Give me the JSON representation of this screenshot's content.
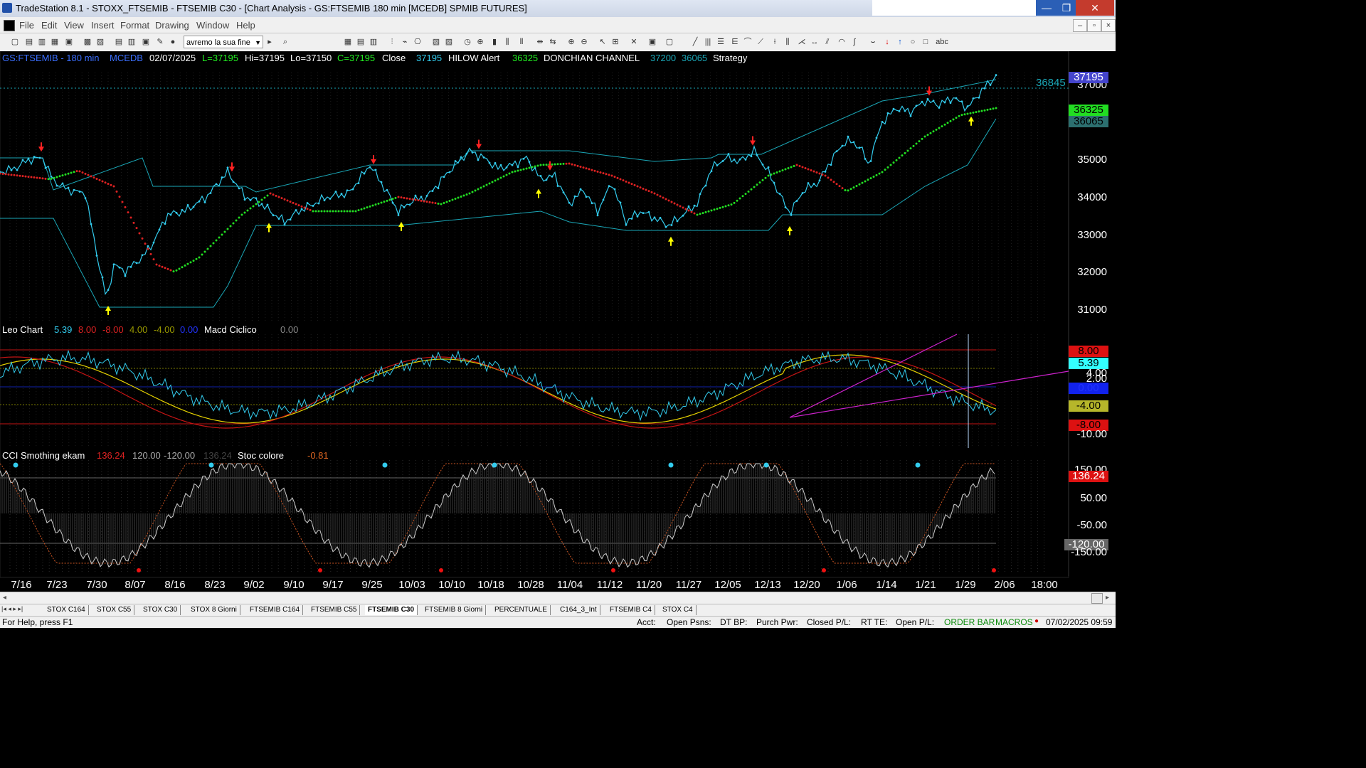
{
  "window": {
    "title": "TradeStation 8.1 - STOXX_FTSEMIB - FTSEMIB C30 - [Chart Analysis - GS:FTSEMIB  180 min  [MCEDB] SPMIB FUTURES]",
    "controls": [
      "—",
      "❐",
      "✕"
    ]
  },
  "menu": {
    "items": [
      "File",
      "Edit",
      "View",
      "Insert",
      "Format",
      "Drawing",
      "Window",
      "Help"
    ],
    "mdi_controls": [
      "–",
      "▫",
      "×"
    ]
  },
  "toolbar": {
    "combo_value": "avremo la sua fine"
  },
  "chart": {
    "header": {
      "symbol": "GS:FTSEMIB - 180 min",
      "feed": "MCEDB",
      "date": "02/07/2025",
      "last": "L=37195",
      "high": "Hi=37195",
      "low": "Lo=37150",
      "close_val": "C=37195",
      "close_label": "Close",
      "close_num": "37195",
      "hilow_label": "HILOW Alert",
      "hilow_val": "36325",
      "donchian_label": "DONCHIAN CHANNEL",
      "donchian_hi": "37200",
      "donchian_lo": "36065",
      "strategy": "Strategy",
      "right_value": "36845"
    },
    "price_axis": [
      "37000",
      "35000",
      "34000",
      "33000",
      "32000",
      "31000"
    ],
    "price_badges": {
      "last": "37195",
      "hilow": "36325",
      "donchian": "36065"
    },
    "leo": {
      "name": "Leo Chart",
      "v1": "5.39",
      "v2": "8.00",
      "v3": "-8.00",
      "v4": "4.00",
      "v5": "-4.00",
      "v6": "0.00",
      "macd_name": "Macd Ciclico",
      "macd_val": "0.00",
      "axis": [
        "8.00",
        "5.39",
        "4.00",
        "2.00",
        "0.00",
        "-4.00",
        "-8.00",
        "-10.00"
      ]
    },
    "cci": {
      "name": "CCI Smothing ekam",
      "v1": "136.24",
      "v2": "120.00",
      "v3": "-120.00",
      "v4": "136.24",
      "stoc_name": "Stoc colore",
      "stoc_val": "-0.81",
      "axis": [
        "150.00",
        "136.24",
        "50.00",
        "-50.00",
        "-120.00",
        "-150.00"
      ]
    },
    "x_axis": [
      "7/16",
      "7/23",
      "7/30",
      "8/07",
      "8/16",
      "8/23",
      "9/02",
      "9/10",
      "9/17",
      "9/25",
      "10/03",
      "10/10",
      "10/18",
      "10/28",
      "11/04",
      "11/12",
      "11/20",
      "11/27",
      "12/05",
      "12/13",
      "12/20",
      "1/06",
      "1/14",
      "1/21",
      "1/29",
      "2/06",
      "18:00"
    ]
  },
  "tabs": [
    "STOX C164",
    "STOX C55",
    "STOX  C30",
    "STOX  8 Giorni",
    "FTSEMIB C164",
    "FTSEMIB C55",
    "FTSEMIB C30",
    "FTSEMIB  8 Giorni",
    "PERCENTUALE",
    "C164_3_Int",
    "FTSEMIB C4",
    "STOX  C4"
  ],
  "active_tab": "FTSEMIB C30",
  "status": {
    "help": "For Help, press F1",
    "acct": "Acct:",
    "open_psns": "Open Psns:",
    "dt_bp": "DT BP:",
    "purch_pwr": "Purch Pwr:",
    "closed_pl": "Closed P/L:",
    "rt_te": "RT TE:",
    "open_pl": "Open P/L:",
    "order_bar": "ORDER BAR",
    "macros": "MACROS",
    "datetime": "07/02/2025 09:59"
  },
  "colors": {
    "price": "#33ccee",
    "channel": "#1aa7b7",
    "ma_up": "#22dd22",
    "ma_down": "#dd2222",
    "arrow_up": "#ffff00",
    "arrow_down": "#ff2222",
    "osc_yellow": "#e6d200",
    "osc_red": "#c41414",
    "trend": "#cc22cc"
  }
}
